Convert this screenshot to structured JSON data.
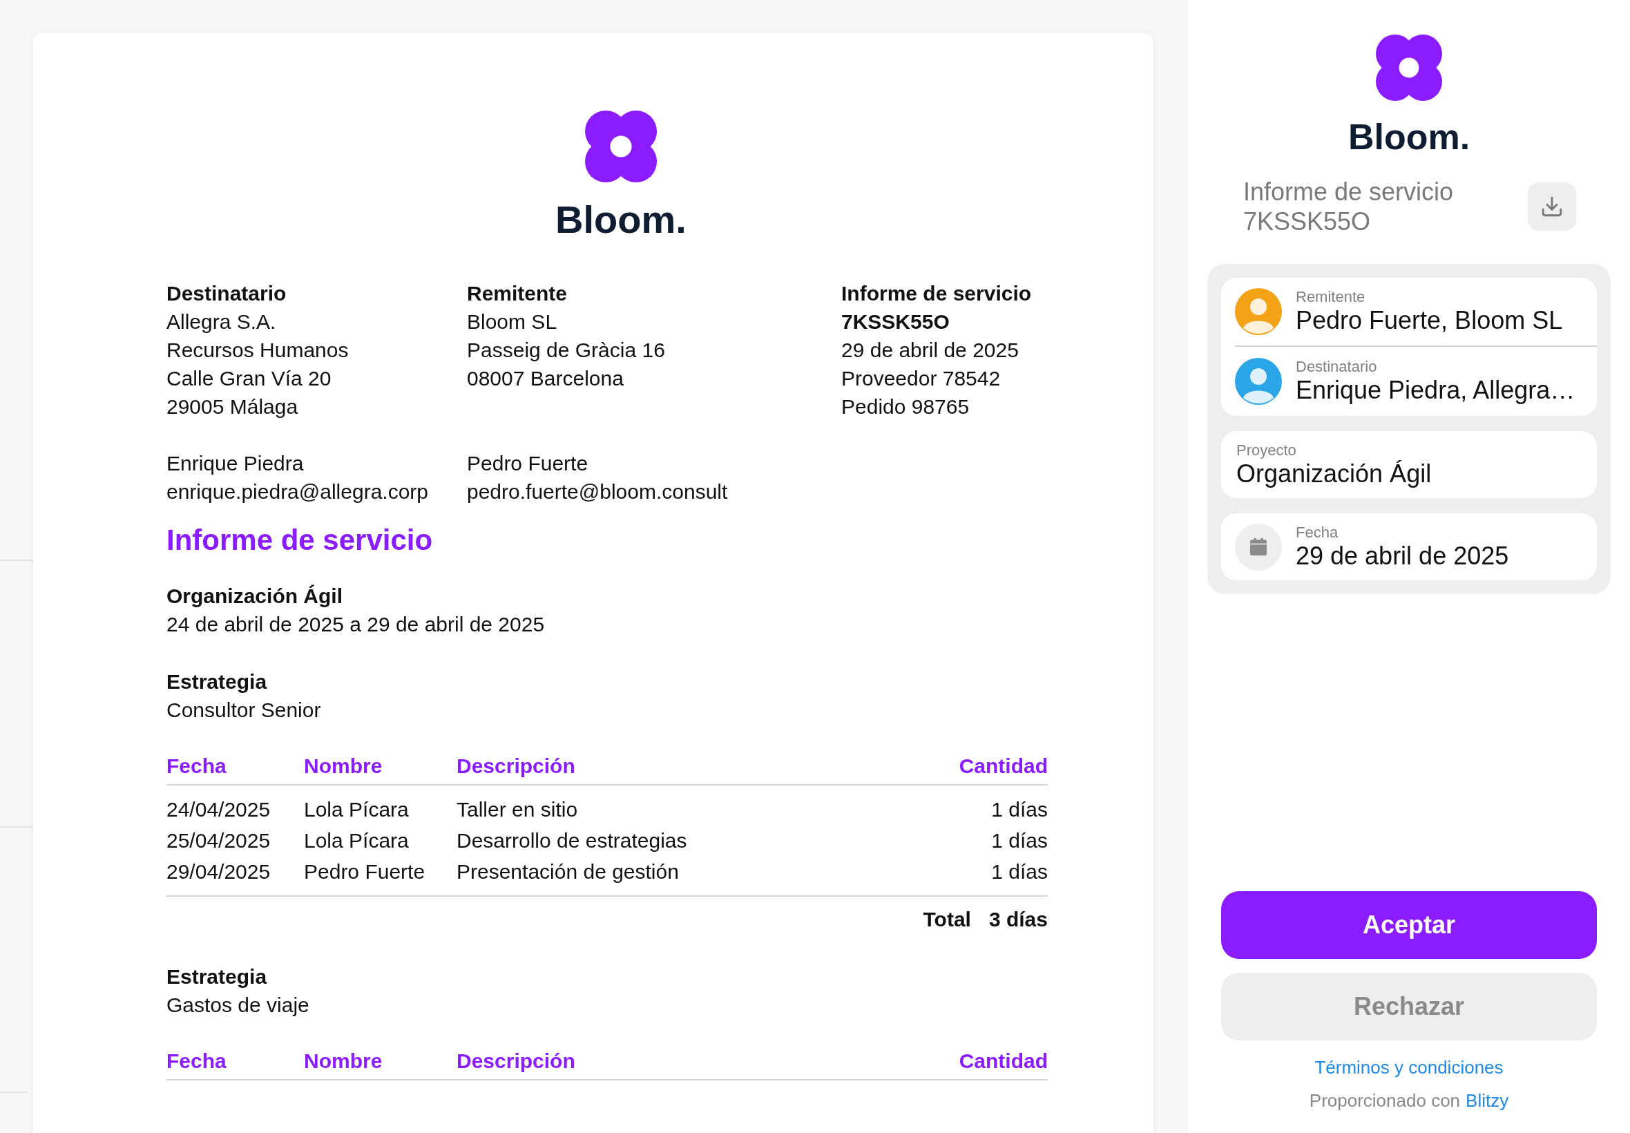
{
  "document": {
    "brand": "Bloom.",
    "parties": [
      {
        "heading": "Destinatario",
        "lines": [
          "Allegra S.A.",
          "Recursos Humanos",
          "Calle Gran Vía 20",
          "29005 Málaga"
        ],
        "contact": [
          "Enrique Piedra",
          "enrique.piedra@allegra.corp"
        ]
      },
      {
        "heading": "Remitente",
        "lines": [
          "Bloom SL",
          "Passeig de Gràcia 16",
          "08007 Barcelona"
        ],
        "contact": [
          "Pedro Fuerte",
          "pedro.fuerte@bloom.consult"
        ]
      }
    ],
    "report": {
      "heading": "Informe de servicio",
      "number": "7KSSK55O",
      "lines": [
        "29 de abril de 2025",
        "Proveedor 78542",
        "Pedido 98765"
      ]
    },
    "title": "Informe de servicio",
    "project": {
      "name": "Organización Ágil",
      "period": "24 de abril de 2025 a 29 de abril de 2025"
    },
    "sections": [
      {
        "heading": "Estrategia",
        "subtitle": "Consultor Senior",
        "columns": [
          "Fecha",
          "Nombre",
          "Descripción",
          "Cantidad"
        ],
        "rows": [
          [
            "24/04/2025",
            "Lola Pícara",
            "Taller en sitio",
            "1 días"
          ],
          [
            "25/04/2025",
            "Lola Pícara",
            "Desarrollo de estrategias",
            "1 días"
          ],
          [
            "29/04/2025",
            "Pedro Fuerte",
            "Presentación de gestión",
            "1 días"
          ]
        ],
        "total_label": "Total",
        "total": "3 días"
      },
      {
        "heading": "Estrategia",
        "subtitle": "Gastos de viaje",
        "columns": [
          "Fecha",
          "Nombre",
          "Descripción",
          "Cantidad"
        ]
      }
    ]
  },
  "sidebar": {
    "brand": "Bloom.",
    "title": "Informe de servicio",
    "number": "7KSSK55O",
    "people": [
      {
        "label": "Remitente",
        "value": "Pedro Fuerte, Bloom SL",
        "color": "#f4a316"
      },
      {
        "label": "Destinatario",
        "value": "Enrique Piedra, Allegra…",
        "color": "#2aa6e8"
      }
    ],
    "project": {
      "label": "Proyecto",
      "value": "Organización Ágil"
    },
    "date": {
      "label": "Fecha",
      "value": "29 de abril de 2025"
    },
    "accept": "Aceptar",
    "reject": "Rechazar",
    "terms": "Términos y condiciones",
    "powered_prefix": "Proporcionado con",
    "powered_link": "Blitzy"
  }
}
